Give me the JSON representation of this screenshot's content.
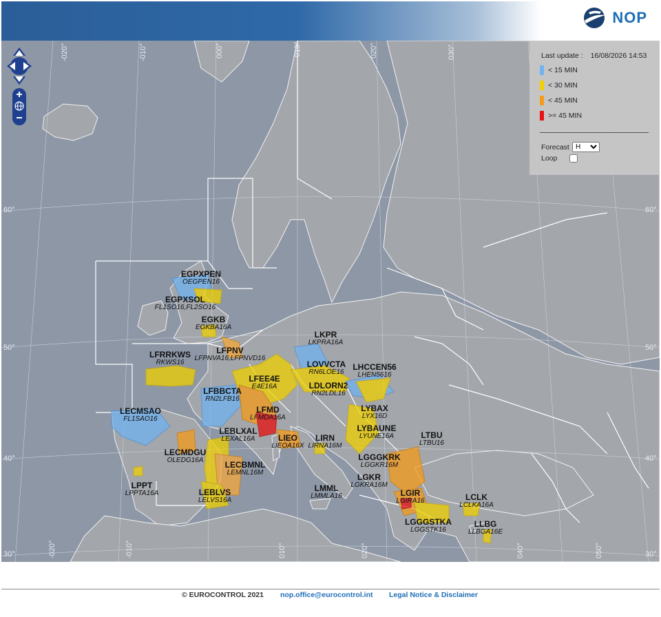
{
  "header": {
    "logo_text": "NOP",
    "brand_color": "#1e6db7"
  },
  "legend": {
    "last_update_label": "Last update :",
    "last_update_value": "16/08/2026 14:53",
    "items": [
      {
        "label": "< 15 MIN",
        "color": "#6fb3f0"
      },
      {
        "label": "< 30 MIN",
        "color": "#f0d000"
      },
      {
        "label": "< 45 MIN",
        "color": "#f59a1a"
      },
      {
        "label": ">= 45 MIN",
        "color": "#e81010"
      }
    ],
    "forecast_label": "Forecast",
    "forecast_value": "H",
    "loop_label": "Loop"
  },
  "grid": {
    "lon_labels": [
      "-020°",
      "-010°",
      "000°",
      "010°",
      "020°",
      "030°",
      "040°",
      "050°"
    ],
    "lat_labels": [
      "60°",
      "50°",
      "40°",
      "30°"
    ]
  },
  "regulations": [
    {
      "code": "EGPXPEN",
      "sub": "OEGPEN16"
    },
    {
      "code": "EGPXSOL",
      "sub": "FL1SO16,FL2SO16"
    },
    {
      "code": "EGKB",
      "sub": "EGKBA16A"
    },
    {
      "code": "LKPR",
      "sub": "LKPRA16A"
    },
    {
      "code": "LFPNV",
      "sub": "LFPNVA16,LFPNVD16"
    },
    {
      "code": "LFRRKWS",
      "sub": "RKWS16"
    },
    {
      "code": "LOVVCTA",
      "sub": "RN6LOE16"
    },
    {
      "code": "LHCCEN56",
      "sub": "LHEN5616"
    },
    {
      "code": "LFEE4E",
      "sub": "E4E16A"
    },
    {
      "code": "LDLORN2",
      "sub": "RN2LDL16"
    },
    {
      "code": "LFBBCTA",
      "sub": "RN2LFB16"
    },
    {
      "code": "LYBAX",
      "sub": "LYX16D"
    },
    {
      "code": "LECMSAO",
      "sub": "FL1SAO16"
    },
    {
      "code": "LFMD",
      "sub": "LFMDA16A"
    },
    {
      "code": "LYBAUNE",
      "sub": "LYUNE16A"
    },
    {
      "code": "LTBU",
      "sub": "LTBU16"
    },
    {
      "code": "LEBLXAL",
      "sub": "LEXAL16A"
    },
    {
      "code": "LIEO",
      "sub": "LIEOA16X"
    },
    {
      "code": "LIRN",
      "sub": "LIRNA16M"
    },
    {
      "code": "LECMDGU",
      "sub": "OLEDG16A"
    },
    {
      "code": "LGGGKRK",
      "sub": "LGGKR16M"
    },
    {
      "code": "LECBMNL",
      "sub": "LEMNL16M"
    },
    {
      "code": "LGKR",
      "sub": "LGKRA16M"
    },
    {
      "code": "LPPT",
      "sub": "LPPTA16A"
    },
    {
      "code": "LMML",
      "sub": "LMMLA16"
    },
    {
      "code": "LCLK",
      "sub": "LCLKA16A"
    },
    {
      "code": "LEBLVS",
      "sub": "LELVS16A"
    },
    {
      "code": "LGIR",
      "sub": "LGIRA16"
    },
    {
      "code": "LGGGSTKA",
      "sub": "LGGSTK16"
    },
    {
      "code": "LLBG",
      "sub": "LLBGA16E"
    }
  ],
  "footer": {
    "copyright": "© EUROCONTROL 2021",
    "email": "nop.office@eurocontrol.int",
    "legal": "Legal Notice & Disclaimer"
  }
}
